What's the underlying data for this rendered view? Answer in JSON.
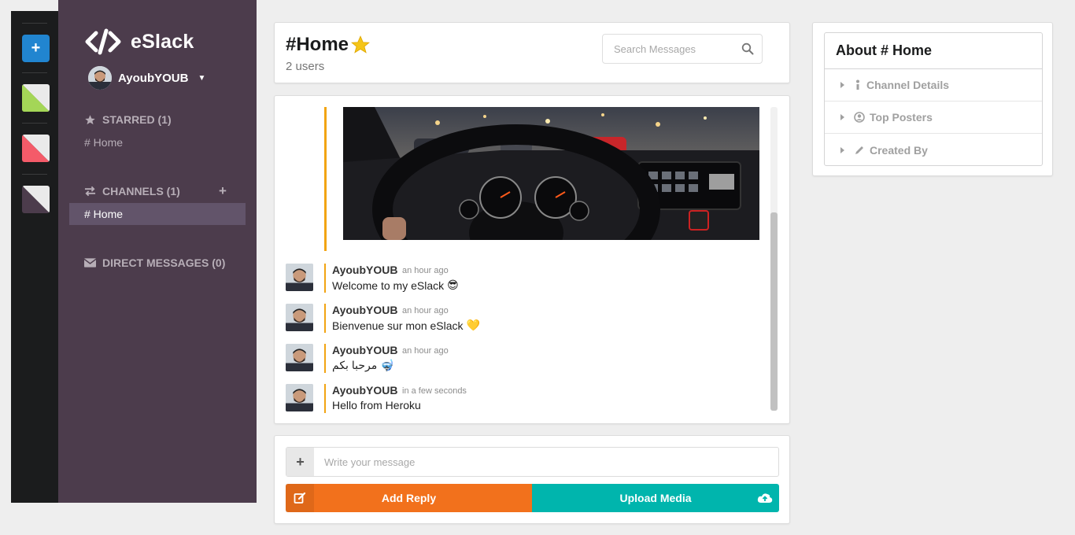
{
  "rail": {
    "add_label": "+",
    "swatches": [
      {
        "color_a": "#a4d657",
        "color_b": "#eaeaea"
      },
      {
        "color_a": "#f45b69",
        "color_b": "#eaeaea"
      },
      {
        "color_a": "#4c3c4c",
        "color_b": "#eaeaea"
      }
    ]
  },
  "sidebar": {
    "brand": "eSlack",
    "user": "AyoubYOUB",
    "starred": {
      "label": "STARRED (1)",
      "items": [
        "# Home"
      ]
    },
    "channels": {
      "label": "CHANNELS (1)",
      "add": "+",
      "items": [
        "# Home"
      ]
    },
    "direct": {
      "label": "DIRECT MESSAGES (0)"
    }
  },
  "header": {
    "channel": "#Home",
    "users": "2 users",
    "search_placeholder": "Search Messages"
  },
  "messages": [
    {
      "author": "AyoubYOUB",
      "time": "an hour ago",
      "text": "Welcome to my eSlack",
      "emoji": "😎"
    },
    {
      "author": "AyoubYOUB",
      "time": "an hour ago",
      "text": "Bienvenue sur mon eSlack",
      "emoji": "💛"
    },
    {
      "author": "AyoubYOUB",
      "time": "an hour ago",
      "text": "مرحبا بكم",
      "emoji": "🤿"
    },
    {
      "author": "AyoubYOUB",
      "time": "in a few seconds",
      "text": "Hello from Heroku",
      "emoji": ""
    }
  ],
  "compose": {
    "placeholder": "Write your message",
    "add": "+",
    "reply_label": "Add Reply",
    "upload_label": "Upload Media"
  },
  "about": {
    "title": "About # Home",
    "items": [
      "Channel Details",
      "Top Posters",
      "Created By"
    ]
  },
  "colors": {
    "sidebar_bg": "#4c3c4c",
    "rail_bg": "#1b1c1d",
    "accent_orange": "#f2711c",
    "accent_teal": "#00b5ad",
    "message_bar": "#f2a413"
  }
}
